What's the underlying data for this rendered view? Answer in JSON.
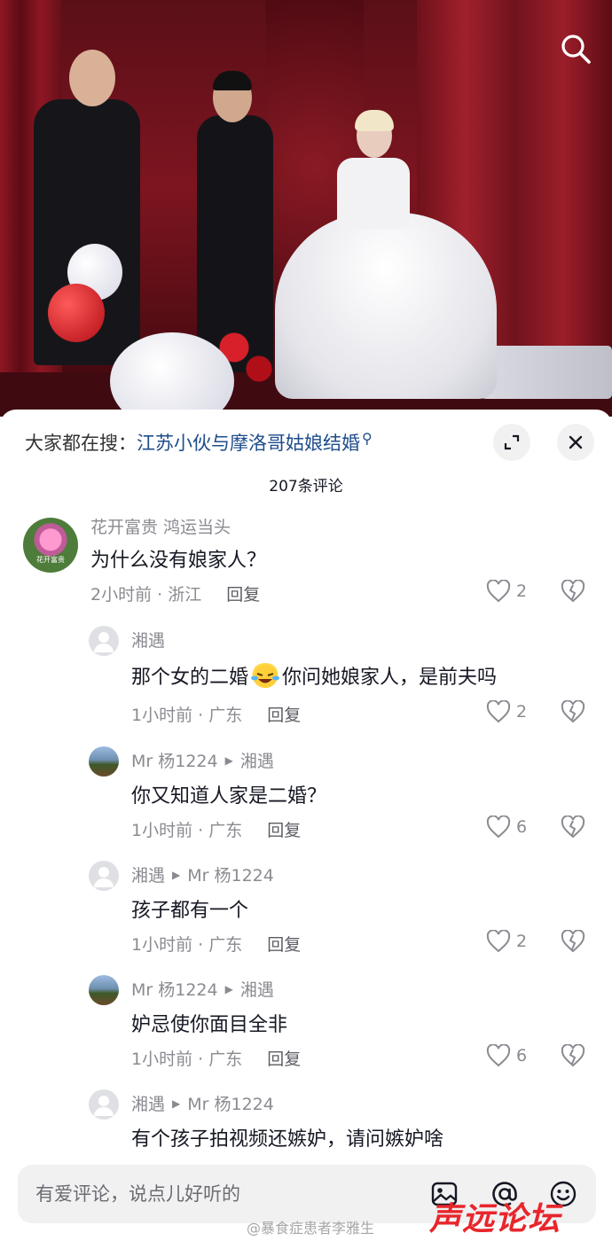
{
  "sheet": {
    "hot_search_prefix": "大家都在搜：",
    "hot_search_link": "江苏小伙与摩洛哥姑娘结婚",
    "comment_count": "207条评论",
    "reply_label": "回复"
  },
  "top_level_avatar_text": "花开富贵",
  "comments": [
    {
      "name": "花开富贵 鸿运当头",
      "reply_to": "",
      "text": "为什么没有娘家人？",
      "time": "2小时前 · 浙江",
      "likes": "2"
    },
    {
      "name": "湘遇",
      "reply_to": "",
      "text_before": "那个女的二婚",
      "text_after": "你问她娘家人，是前夫吗",
      "time": "1小时前 · 广东",
      "likes": "2"
    },
    {
      "name": "Mr 杨1224",
      "reply_to": "湘遇",
      "text": "你又知道人家是二婚？",
      "time": "1小时前 · 广东",
      "likes": "6"
    },
    {
      "name": "湘遇",
      "reply_to": "Mr 杨1224",
      "text": "孩子都有一个",
      "time": "1小时前 · 广东",
      "likes": "2"
    },
    {
      "name": "Mr 杨1224",
      "reply_to": "湘遇",
      "text": "妒忌使你面目全非",
      "time": "1小时前 · 广东",
      "likes": "6"
    },
    {
      "name": "湘遇",
      "reply_to": "Mr 杨1224",
      "text": "有个孩子拍视频还嫉妒，请问嫉妒啥",
      "time": "",
      "likes": ""
    }
  ],
  "input": {
    "placeholder": "有爱评论，说点儿好听的"
  },
  "watermarks": {
    "weibo": "@暴食症患者李雅生",
    "forum": "声远论坛"
  },
  "colors": {
    "link": "#1e4d8c",
    "accent_red": "#e8262c",
    "muted": "#8a8b91"
  },
  "icons": [
    "search-icon",
    "expand-icon",
    "close-icon",
    "heart-icon",
    "broken-heart-icon",
    "image-icon",
    "at-icon",
    "emoji-icon"
  ]
}
